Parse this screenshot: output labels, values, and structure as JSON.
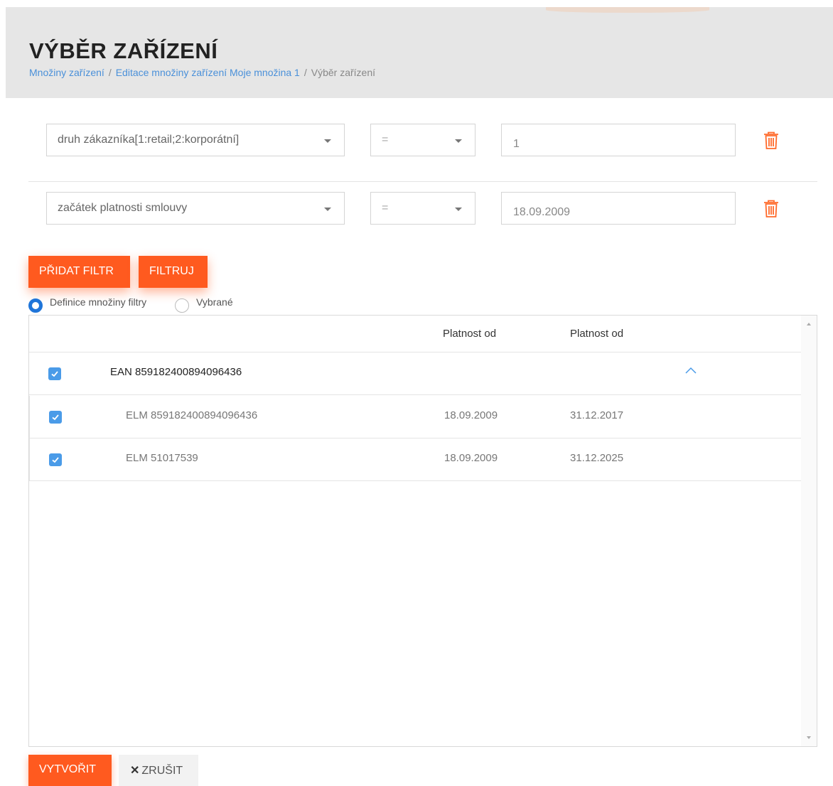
{
  "header": {
    "title": "VÝBĚR ZAŘÍZENÍ",
    "breadcrumb": {
      "link1": "Množiny zařízení",
      "link2": "Editace množiny zařízení Moje množina 1",
      "current": "Výběr zařízení",
      "separator": "/"
    }
  },
  "filters": [
    {
      "field": "druh zákazníka[1:retail;2:korporátní]",
      "operator": "=",
      "value": "1"
    },
    {
      "field": "začátek platnosti smlouvy",
      "operator": "=",
      "value": "18.09.2009"
    }
  ],
  "actions": {
    "add_filter": "PŘIDAT FILTR",
    "filter": "FILTRUJ",
    "create": "VYTVOŘIT",
    "cancel": "ZRUŠIT"
  },
  "mode": {
    "options": [
      "Definice množiny filtry",
      "Vybrané"
    ],
    "selected": "Definice množiny filtry"
  },
  "table": {
    "columns": [
      "Platnost od",
      "Platnost od"
    ],
    "group": {
      "label": "EAN 859182400894096436",
      "checked": true,
      "expanded": true
    },
    "rows": [
      {
        "label": "ELM 859182400894096436",
        "from": "18.09.2009",
        "to": "31.12.2017",
        "checked": true
      },
      {
        "label": "ELM 51017539",
        "from": "18.09.2009",
        "to": "31.12.2025",
        "checked": true
      }
    ]
  },
  "colors": {
    "accent": "#ff5a1f",
    "link": "#4a90d9",
    "checkbox": "#4a9be8",
    "radio": "#1f75d9",
    "trash": "#ff6a2a"
  },
  "icons": {
    "trash": "trash-icon",
    "caret": "caret-down-icon",
    "chevron": "chevron-up-icon",
    "check": "check-icon",
    "close": "close-icon"
  }
}
